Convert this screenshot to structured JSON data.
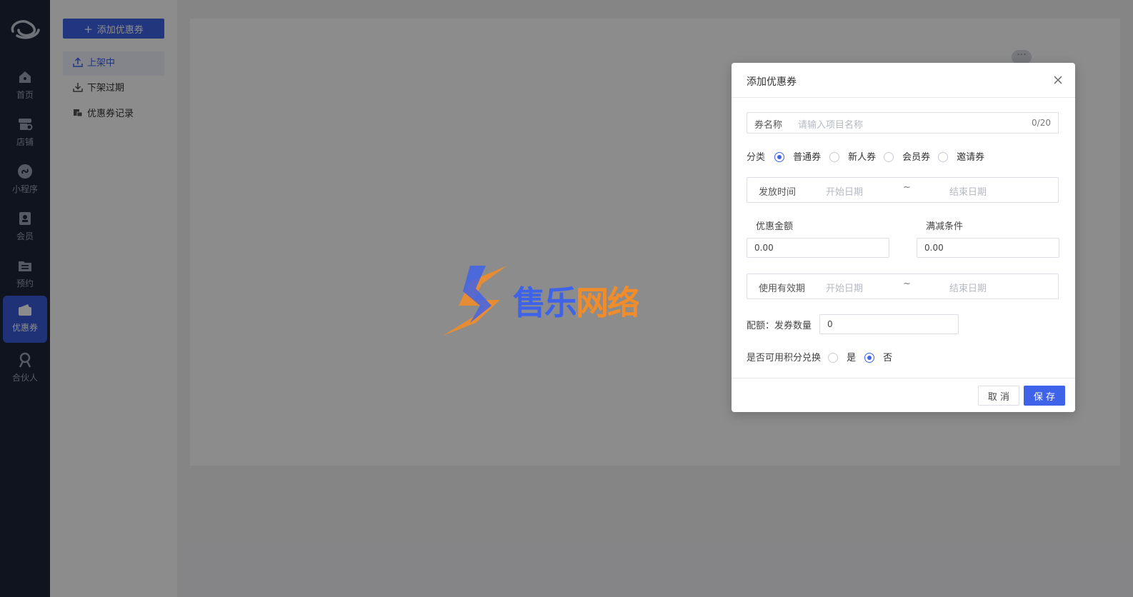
{
  "rail": {
    "items": [
      {
        "label": "首页",
        "icon": "home-icon"
      },
      {
        "label": "店铺",
        "icon": "store-icon"
      },
      {
        "label": "小程序",
        "icon": "miniprogram-icon"
      },
      {
        "label": "会员",
        "icon": "member-icon"
      },
      {
        "label": "预约",
        "icon": "booking-icon"
      },
      {
        "label": "优惠券",
        "icon": "coupon-icon"
      },
      {
        "label": "合伙人",
        "icon": "partner-icon"
      }
    ]
  },
  "submenu": {
    "add_button": "添加优惠券",
    "items": [
      {
        "label": "上架中",
        "icon": "upload-icon"
      },
      {
        "label": "下架过期",
        "icon": "download-icon"
      },
      {
        "label": "优惠券记录",
        "icon": "record-icon"
      }
    ]
  },
  "watermark": {
    "text": "售乐网络"
  },
  "dialog": {
    "title": "添加优惠券",
    "name_label": "券名称",
    "name_placeholder": "请输入项目名称",
    "name_counter": "0/20",
    "category_label": "分类",
    "category_options": [
      "普通券",
      "新人券",
      "会员券",
      "邀请券"
    ],
    "category_selected": "普通券",
    "issue_time_label": "发放时间",
    "start_date_placeholder": "开始日期",
    "range_separator": "~",
    "end_date_placeholder": "结束日期",
    "discount_label": "优惠金额",
    "discount_value": "0.00",
    "threshold_label": "满减条件",
    "threshold_value": "0.00",
    "validity_label": "使用有效期",
    "quota_label": "配额：发券数量",
    "quota_value": "0",
    "points_label": "是否可用积分兑换",
    "points_yes": "是",
    "points_no": "否",
    "points_selected": "否",
    "cancel_button": "取 消",
    "save_button": "保 存"
  },
  "colors": {
    "accent": "#3f63e8",
    "rail_bg": "#1e2637",
    "watermark_blue": "#3f63e8",
    "watermark_orange": "#f08c2a"
  }
}
